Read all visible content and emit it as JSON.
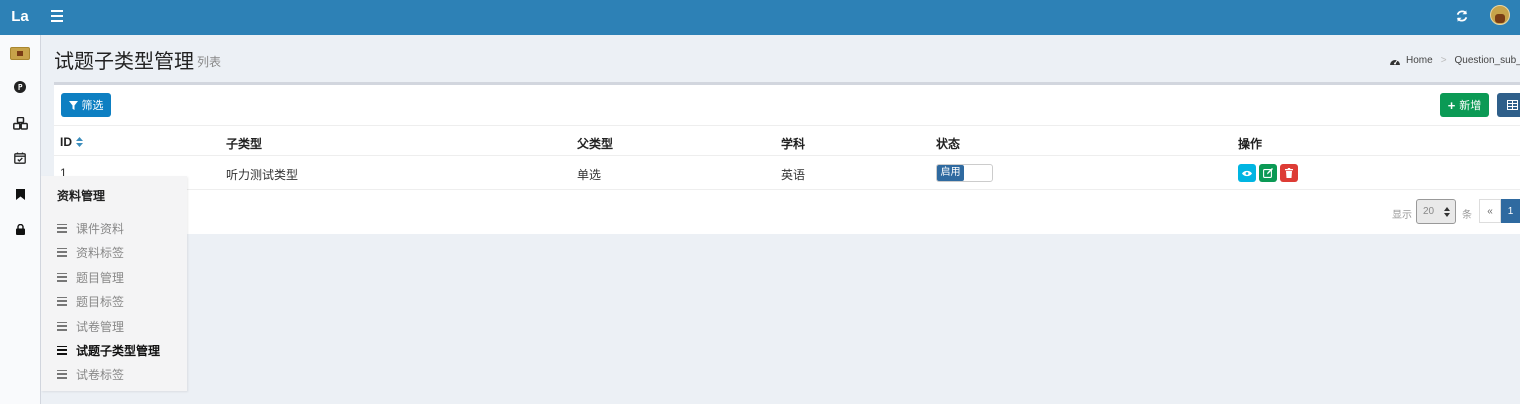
{
  "header": {
    "logo": "La"
  },
  "flyout": {
    "title": "资料管理",
    "items": [
      {
        "label": "课件资料",
        "active": false
      },
      {
        "label": "资料标签",
        "active": false
      },
      {
        "label": "题目管理",
        "active": false
      },
      {
        "label": "题目标签",
        "active": false
      },
      {
        "label": "试卷管理",
        "active": false
      },
      {
        "label": "试题子类型管理",
        "active": true
      },
      {
        "label": "试卷标签",
        "active": false
      }
    ]
  },
  "content": {
    "title": "试题子类型管理",
    "subtitle": "列表",
    "breadcrumb": {
      "home": "Home",
      "current": "Question_sub_ty"
    }
  },
  "toolbar": {
    "filter_label": "筛选",
    "add_label": "新增"
  },
  "table": {
    "columns": [
      "ID",
      "子类型",
      "父类型",
      "学科",
      "状态",
      "操作"
    ],
    "rows": [
      {
        "id": "1",
        "subtype": "听力测试类型",
        "parent": "单选",
        "subject": "英语",
        "status": "启用"
      }
    ]
  },
  "pagination": {
    "show_label": "显示",
    "per_page": "20",
    "unit_label": "条",
    "prev": "«",
    "current_page": "1"
  },
  "colors": {
    "topbar": "#2d81b6",
    "primary": "#0d7fc2",
    "success": "#0b9a55",
    "danger": "#dd3c35",
    "info": "#00b5e2"
  }
}
